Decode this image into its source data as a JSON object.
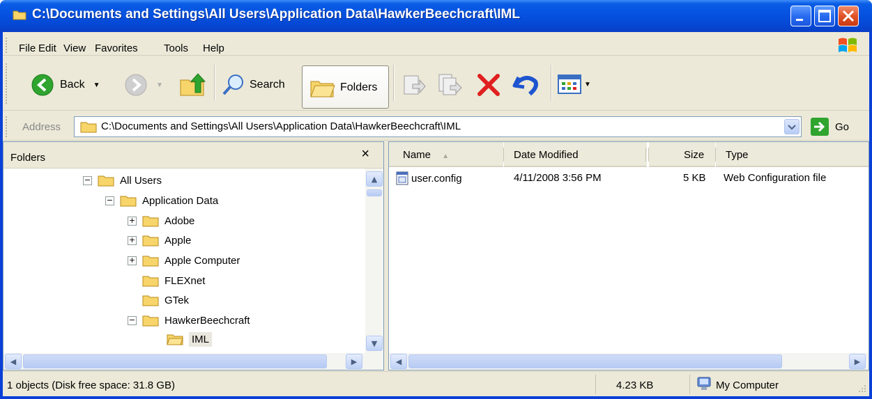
{
  "window": {
    "title": "C:\\Documents and Settings\\All Users\\Application Data\\HawkerBeechcraft\\IML"
  },
  "menu": {
    "items": [
      "File",
      "Edit",
      "View",
      "Favorites",
      "Tools",
      "Help"
    ]
  },
  "toolbar": {
    "back_label": "Back",
    "search_label": "Search",
    "folders_label": "Folders"
  },
  "address": {
    "label": "Address",
    "value": "C:\\Documents and Settings\\All Users\\Application Data\\HawkerBeechcraft\\IML",
    "go_label": "Go"
  },
  "folders_pane": {
    "title": "Folders",
    "close_glyph": "×",
    "tree": [
      {
        "label": "All Users",
        "expander": "−"
      },
      {
        "label": "Application Data",
        "expander": "−"
      },
      {
        "label": "Adobe",
        "expander": "+"
      },
      {
        "label": "Apple",
        "expander": "+"
      },
      {
        "label": "Apple Computer",
        "expander": "+"
      },
      {
        "label": "FLEXnet",
        "expander": ""
      },
      {
        "label": "GTek",
        "expander": ""
      },
      {
        "label": "HawkerBeechcraft",
        "expander": "−"
      },
      {
        "label": "IML",
        "expander": ""
      }
    ]
  },
  "file_list": {
    "columns": [
      "Name",
      "Date Modified",
      "Size",
      "Type"
    ],
    "rows": [
      {
        "name": "user.config",
        "date": "4/11/2008 3:56 PM",
        "size": "5 KB",
        "type": "Web Configuration file"
      }
    ]
  },
  "status": {
    "objects": "1 objects (Disk free space: 31.8 GB)",
    "size": "4.23 KB",
    "location": "My Computer"
  },
  "colors": {
    "titlebar": "#0552e0",
    "chrome": "#ece9d8",
    "close_button": "#e1532a",
    "delete_icon": "#e02020",
    "go_icon": "#2fa42f"
  }
}
